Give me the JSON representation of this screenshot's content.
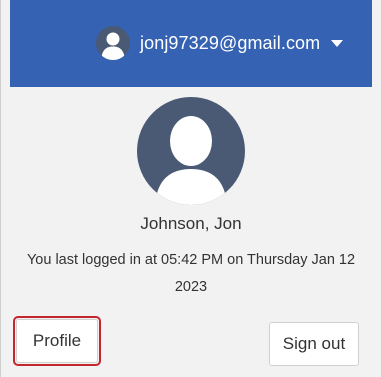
{
  "header": {
    "account_email": "jonj97329@gmail.com",
    "avatar_icon": "user-avatar-icon",
    "dropdown_icon": "caret-down-icon"
  },
  "profile": {
    "display_name": "Johnson, Jon",
    "last_login_text": "You last logged in at 05:42 PM on Thursday Jan 12 2023"
  },
  "actions": {
    "profile_label": "Profile",
    "signout_label": "Sign out"
  },
  "colors": {
    "header_bg": "#3562b3",
    "panel_bg": "#f2f2f2",
    "avatar_bg": "#4a5a75",
    "highlight": "#c4262e"
  }
}
